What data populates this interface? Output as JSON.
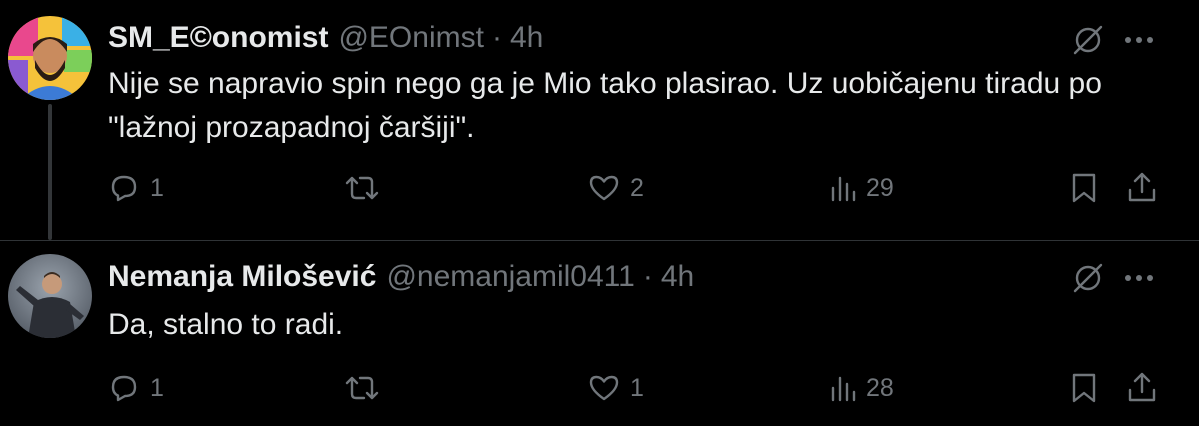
{
  "tweets": [
    {
      "author": {
        "display_name": "SM_E©onomist",
        "handle": "@EOnimst",
        "avatar_icon": "avatar-illustrated-bearded-man"
      },
      "separator": "·",
      "time": "4h",
      "text": "Nije se napravio spin nego ga je Mio tako plasirao. Uz uobičajenu tiradu po \"lažnoj prozapadnoj čaršiji\".",
      "stats": {
        "replies": "1",
        "retweets": "",
        "likes": "2",
        "views": "29"
      }
    },
    {
      "author": {
        "display_name": "Nemanja Milošević",
        "handle": "@nemanjamil0411",
        "avatar_icon": "avatar-photo-person-on-stage"
      },
      "separator": "·",
      "time": "4h",
      "text": "Da, stalno to radi.",
      "stats": {
        "replies": "1",
        "retweets": "",
        "likes": "1",
        "views": "28"
      }
    }
  ],
  "icons": {
    "reply": "reply-icon",
    "retweet": "retweet-icon",
    "like": "heart-icon",
    "views": "views-icon",
    "bookmark": "bookmark-icon",
    "share": "share-icon",
    "grok": "grok-icon",
    "more": "more-icon"
  },
  "colors": {
    "background": "#000000",
    "primary_text": "#e7e9ea",
    "secondary_text": "#71767b",
    "thread_line": "#333639"
  }
}
